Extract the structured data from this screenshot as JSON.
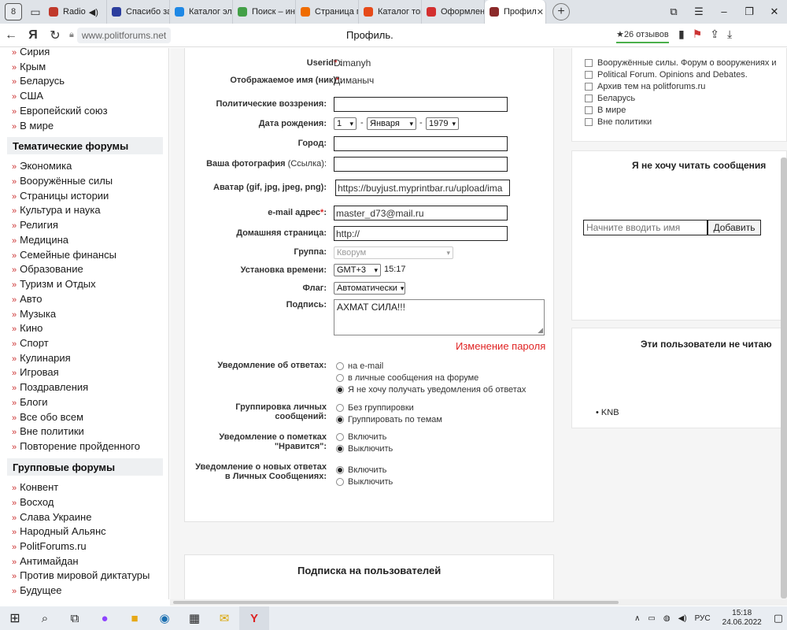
{
  "browser": {
    "tab_count": "8",
    "tabs": [
      {
        "label": "Radio",
        "color": "#c0392b"
      },
      {
        "label": "Спасибо за",
        "color": "#2c3e9e"
      },
      {
        "label": "Каталог эле",
        "color": "#1e88e5"
      },
      {
        "label": "Поиск – ин",
        "color": "#43a047"
      },
      {
        "label": "Страница п",
        "color": "#ef6c00"
      },
      {
        "label": "Каталог тов",
        "color": "#e64a19"
      },
      {
        "label": "Оформлен",
        "color": "#d32f2f"
      },
      {
        "label": "Профил",
        "color": "#8b2a2a"
      }
    ],
    "url": "www.politforums.net",
    "page_title": "Профиль.",
    "reviews": "★26 отзывов"
  },
  "sidebar": {
    "top_items": [
      "Сирия",
      "Крым",
      "Беларусь",
      "США",
      "Европейский союз",
      "В мире"
    ],
    "thematic_title": "Тематические форумы",
    "thematic_items": [
      "Экономика",
      "Вооружённые силы",
      "Страницы истории",
      "Культура и наука",
      "Религия",
      "Медицина",
      "Семейные финансы",
      "Образование",
      "Туризм и Отдых",
      "Авто",
      "Музыка",
      "Кино",
      "Спорт",
      "Кулинария",
      "Игровая",
      "Поздравления",
      "Блоги",
      "Все обо всем",
      "Вне политики",
      "Повторение пройденного"
    ],
    "group_title": "Групповые форумы",
    "group_items": [
      "Конвент",
      "Восход",
      "Слава Украине",
      "Народный Альянс",
      "PolitForums.ru",
      "Антимайдан",
      "Против мировой диктатуры",
      "Будущее"
    ]
  },
  "form": {
    "userid_label": "Userid",
    "userid_value": "Dimanyh",
    "display_label": "Отображаемое имя (ник)",
    "display_value": "Диманыч",
    "political_label": "Политические воззрения",
    "political_value": "",
    "birth_label": "Дата рождения",
    "birth_day": "1",
    "birth_month": "Января",
    "birth_year": "1979",
    "dash": "-",
    "city_label": "Город",
    "city_value": "",
    "photo_label_bold": "Ваша фотография",
    "photo_label_normal": "(Ссылка)",
    "photo_value": "",
    "avatar_label": "Аватар (gif, jpg, jpeg, png):",
    "avatar_value": "https://buyjust.myprintbar.ru/upload/ima",
    "email_label": "e-mail адрес",
    "email_value": "master_d73@mail.ru",
    "home_label": "Домашняя страница",
    "home_value": "http://",
    "group_label": "Группа",
    "group_value": "Кворум",
    "time_label": "Установка времени",
    "time_value": "GMT+3",
    "time_now": "15:17",
    "flag_label": "Флаг",
    "flag_value": "Автоматически",
    "signature_label": "Подпись",
    "signature_value": "АХМАТ СИЛА!!!",
    "change_password": "Изменение пароля",
    "notify_label": "Уведомление об ответах",
    "notify_options": [
      "на e-mail",
      "в личные сообщения на форуме",
      "Я не хочу получать уведомления об ответах"
    ],
    "grouping_label": "Группировка личных сообщений",
    "grouping_options": [
      "Без группировки",
      "Группировать по темам"
    ],
    "likes_label": "Уведомление о пометках \"Нравится\"",
    "likes_options": [
      "Включить",
      "Выключить"
    ],
    "pm_label": "Уведомление о новых ответах в Личных Сообщениях",
    "pm_options": [
      "Включить",
      "Выключить"
    ]
  },
  "subscriptions_title": "Подписка на пользователей",
  "right": {
    "forums": [
      "Вооружённые силы. Форум о вооружениях и",
      "Political Forum. Opinions and Debates.",
      "Архив тем на politforums.ru",
      "Беларусь",
      "В мире",
      "Вне политики"
    ],
    "block_title": "Я не хочу читать сообщения",
    "name_placeholder": "Начните вводить имя",
    "add_button": "Добавить",
    "ignored_title": "Эти пользователи не читаю",
    "ignored_users": [
      "KNB"
    ]
  },
  "taskbar": {
    "lang": "РУС",
    "time": "15:18",
    "date": "24.06.2022"
  }
}
